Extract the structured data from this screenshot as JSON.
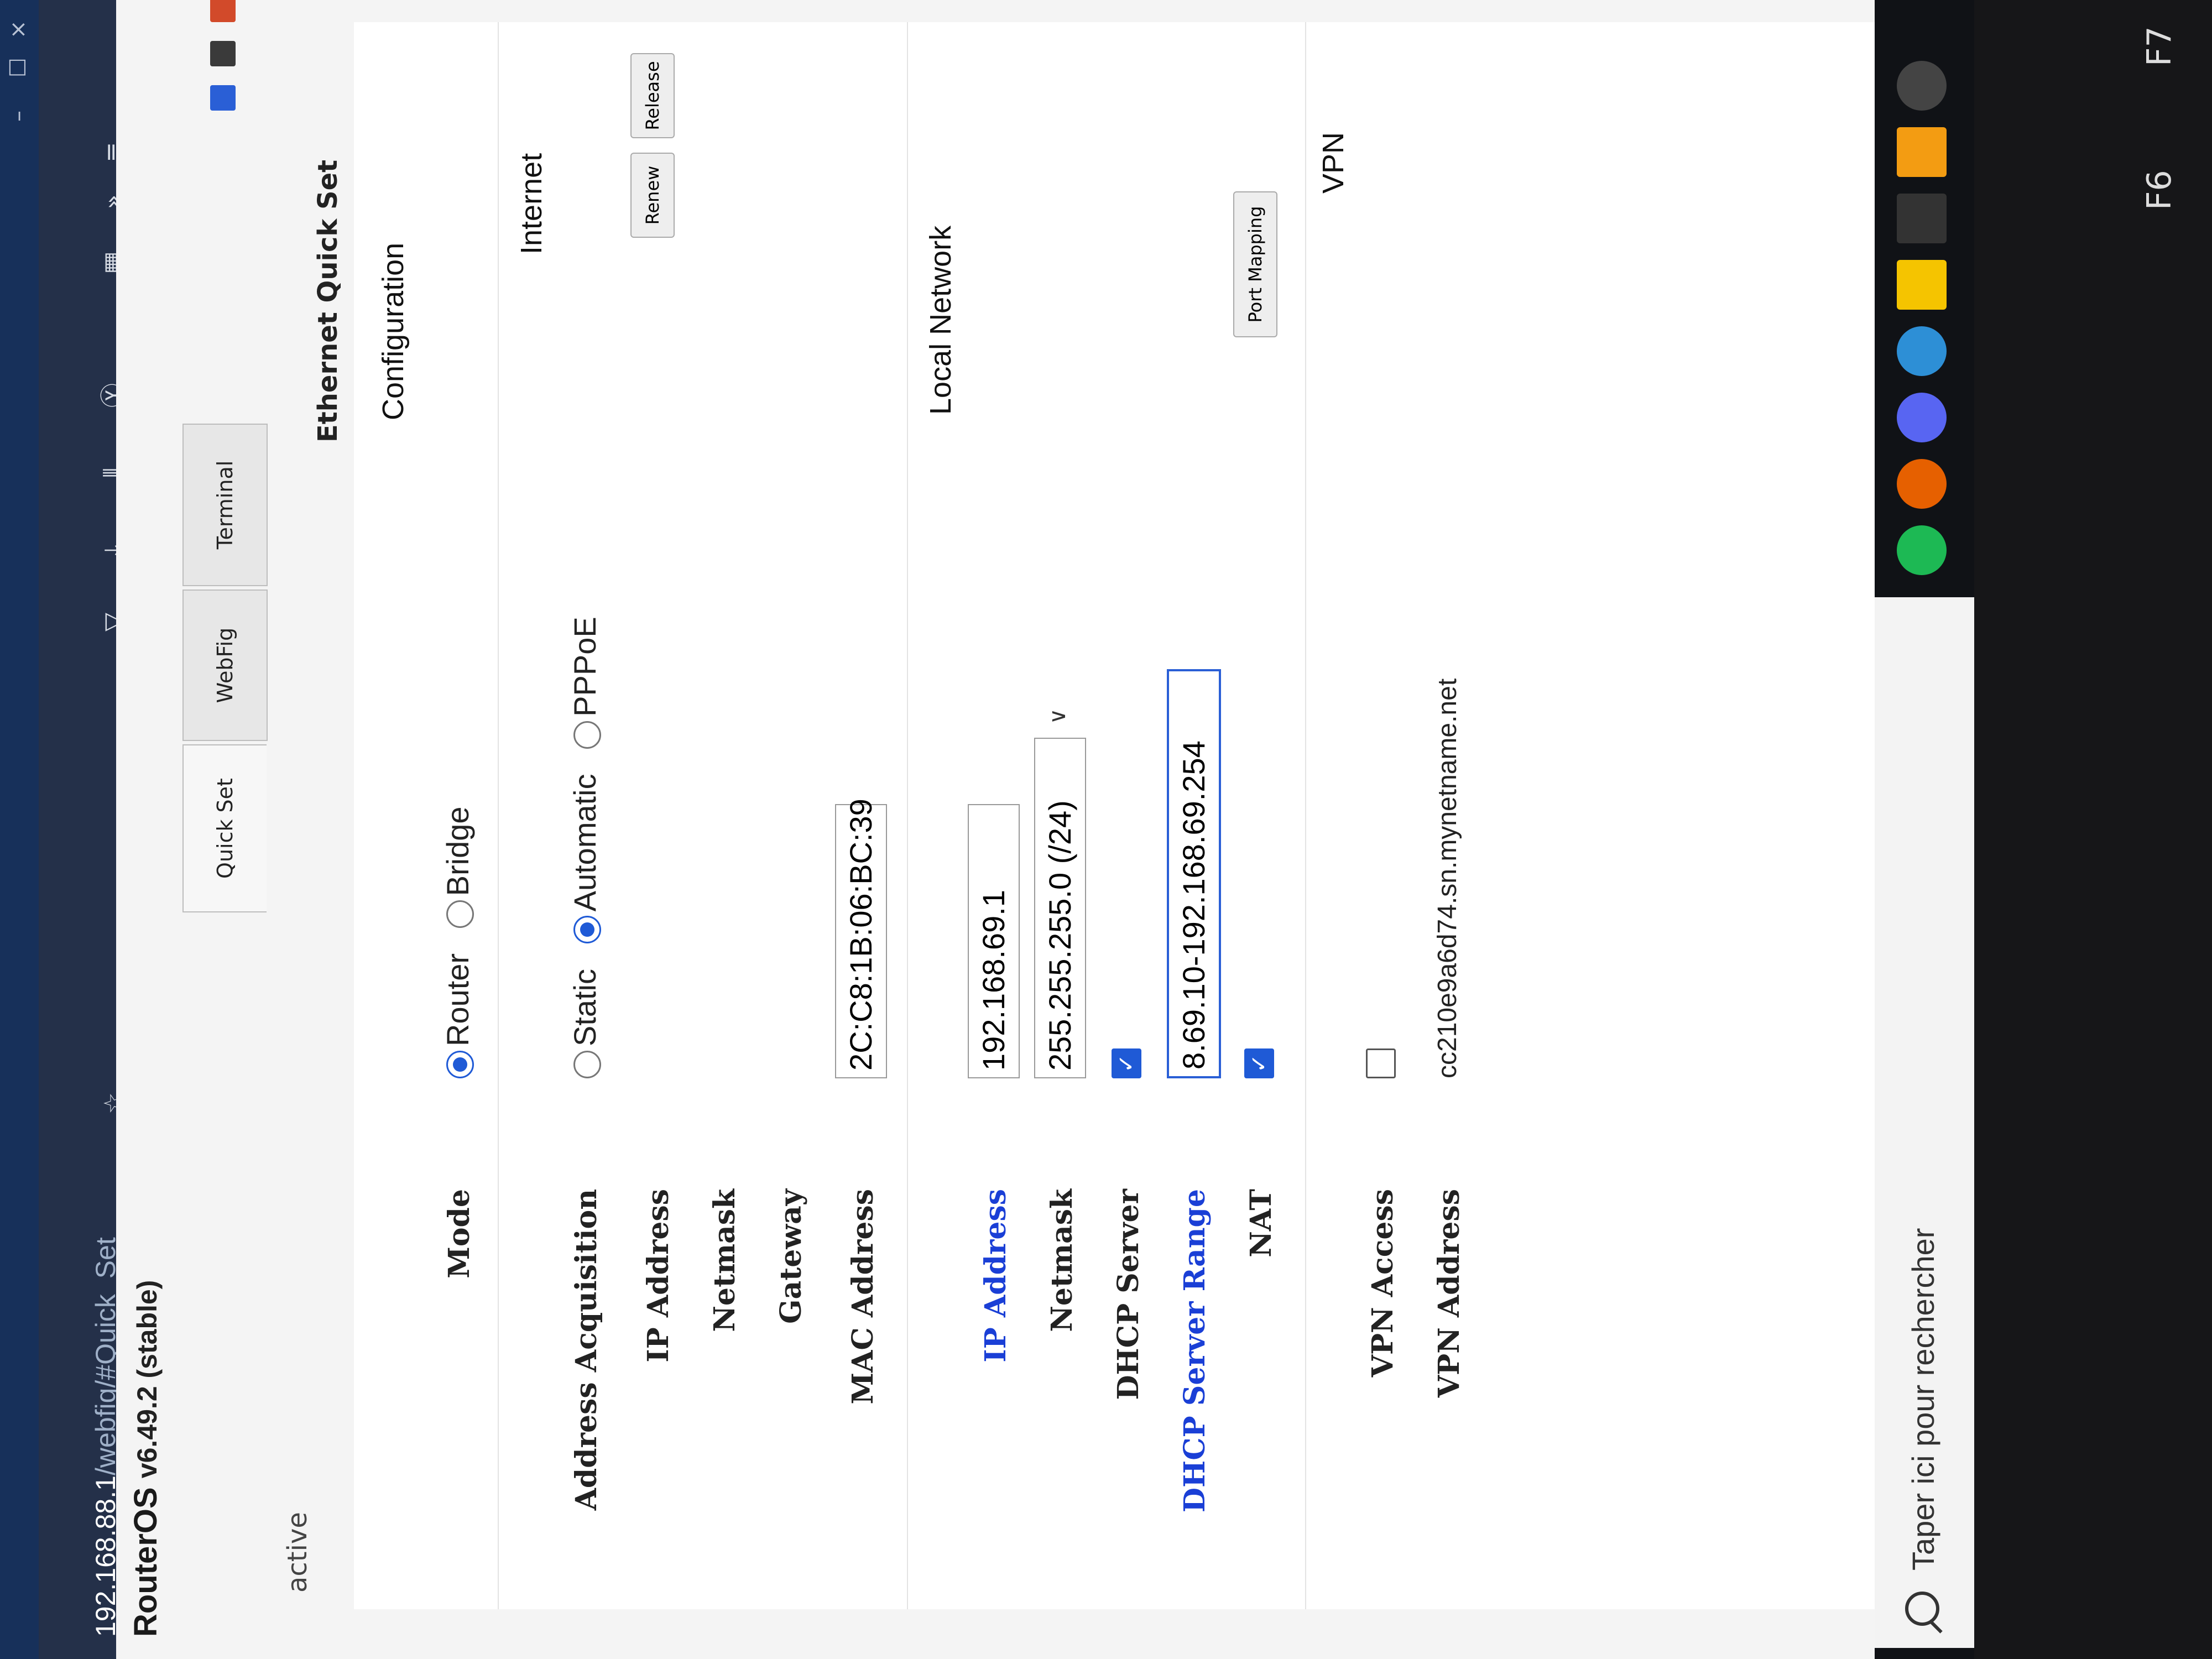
{
  "browser": {
    "url_host": "192.168.88.1",
    "url_path": "/webfig/#Quick_Set",
    "star_icon": "star-icon",
    "win_close": "×"
  },
  "header": {
    "app_name": "RouterOS",
    "version": "v6.49.2 (stable)",
    "status": "active"
  },
  "tabs": [
    {
      "label": "Quick Set"
    },
    {
      "label": "WebFig"
    },
    {
      "label": "Terminal"
    }
  ],
  "page_title": "Ethernet Quick Set",
  "sections": {
    "configuration": "Configuration",
    "internet": "Internet",
    "local_network": "Local Network",
    "vpn": "VPN"
  },
  "form": {
    "mode_label": "Mode",
    "mode_options": [
      "Router",
      "Bridge"
    ],
    "mode_selected": "Router",
    "address_acquisition_label": "Address Acquisition",
    "address_options": [
      "Static",
      "Automatic",
      "PPPoE"
    ],
    "address_selected": "Automatic",
    "ip_address_label": "IP Address",
    "netmask_label": "Netmask",
    "gateway_label": "Gateway",
    "mac_address_label": "MAC Address",
    "mac_address_value": "2C:C8:1B:06:BC:39",
    "renew_label": "Renew",
    "release_label": "Release",
    "lan_ip_label": "IP Address",
    "lan_ip_value": "192.168.69.1",
    "lan_netmask_label": "Netmask",
    "lan_netmask_value": "255.255.255.0 (/24)",
    "dhcp_server_label": "DHCP Server",
    "dhcp_server_checked": true,
    "dhcp_range_label": "DHCP Server Range",
    "dhcp_range_value": "8.69.10-192.168.69.254",
    "nat_label": "NAT",
    "nat_checked": true,
    "port_mapping_label": "Port Mapping",
    "vpn_access_label": "VPN Access",
    "vpn_access_checked": false,
    "vpn_address_label": "VPN Address",
    "vpn_address_value": "cc210e9a6d74.sn.mynetname.net"
  },
  "taskbar": {
    "search_placeholder": "Taper ici pour rechercher"
  },
  "keyboard": {
    "f6": "F6",
    "f7": "F7"
  },
  "colors": {
    "accent": "#1f5ad6",
    "label_blue": "#1a3fd6",
    "browser_bar": "#243049"
  }
}
